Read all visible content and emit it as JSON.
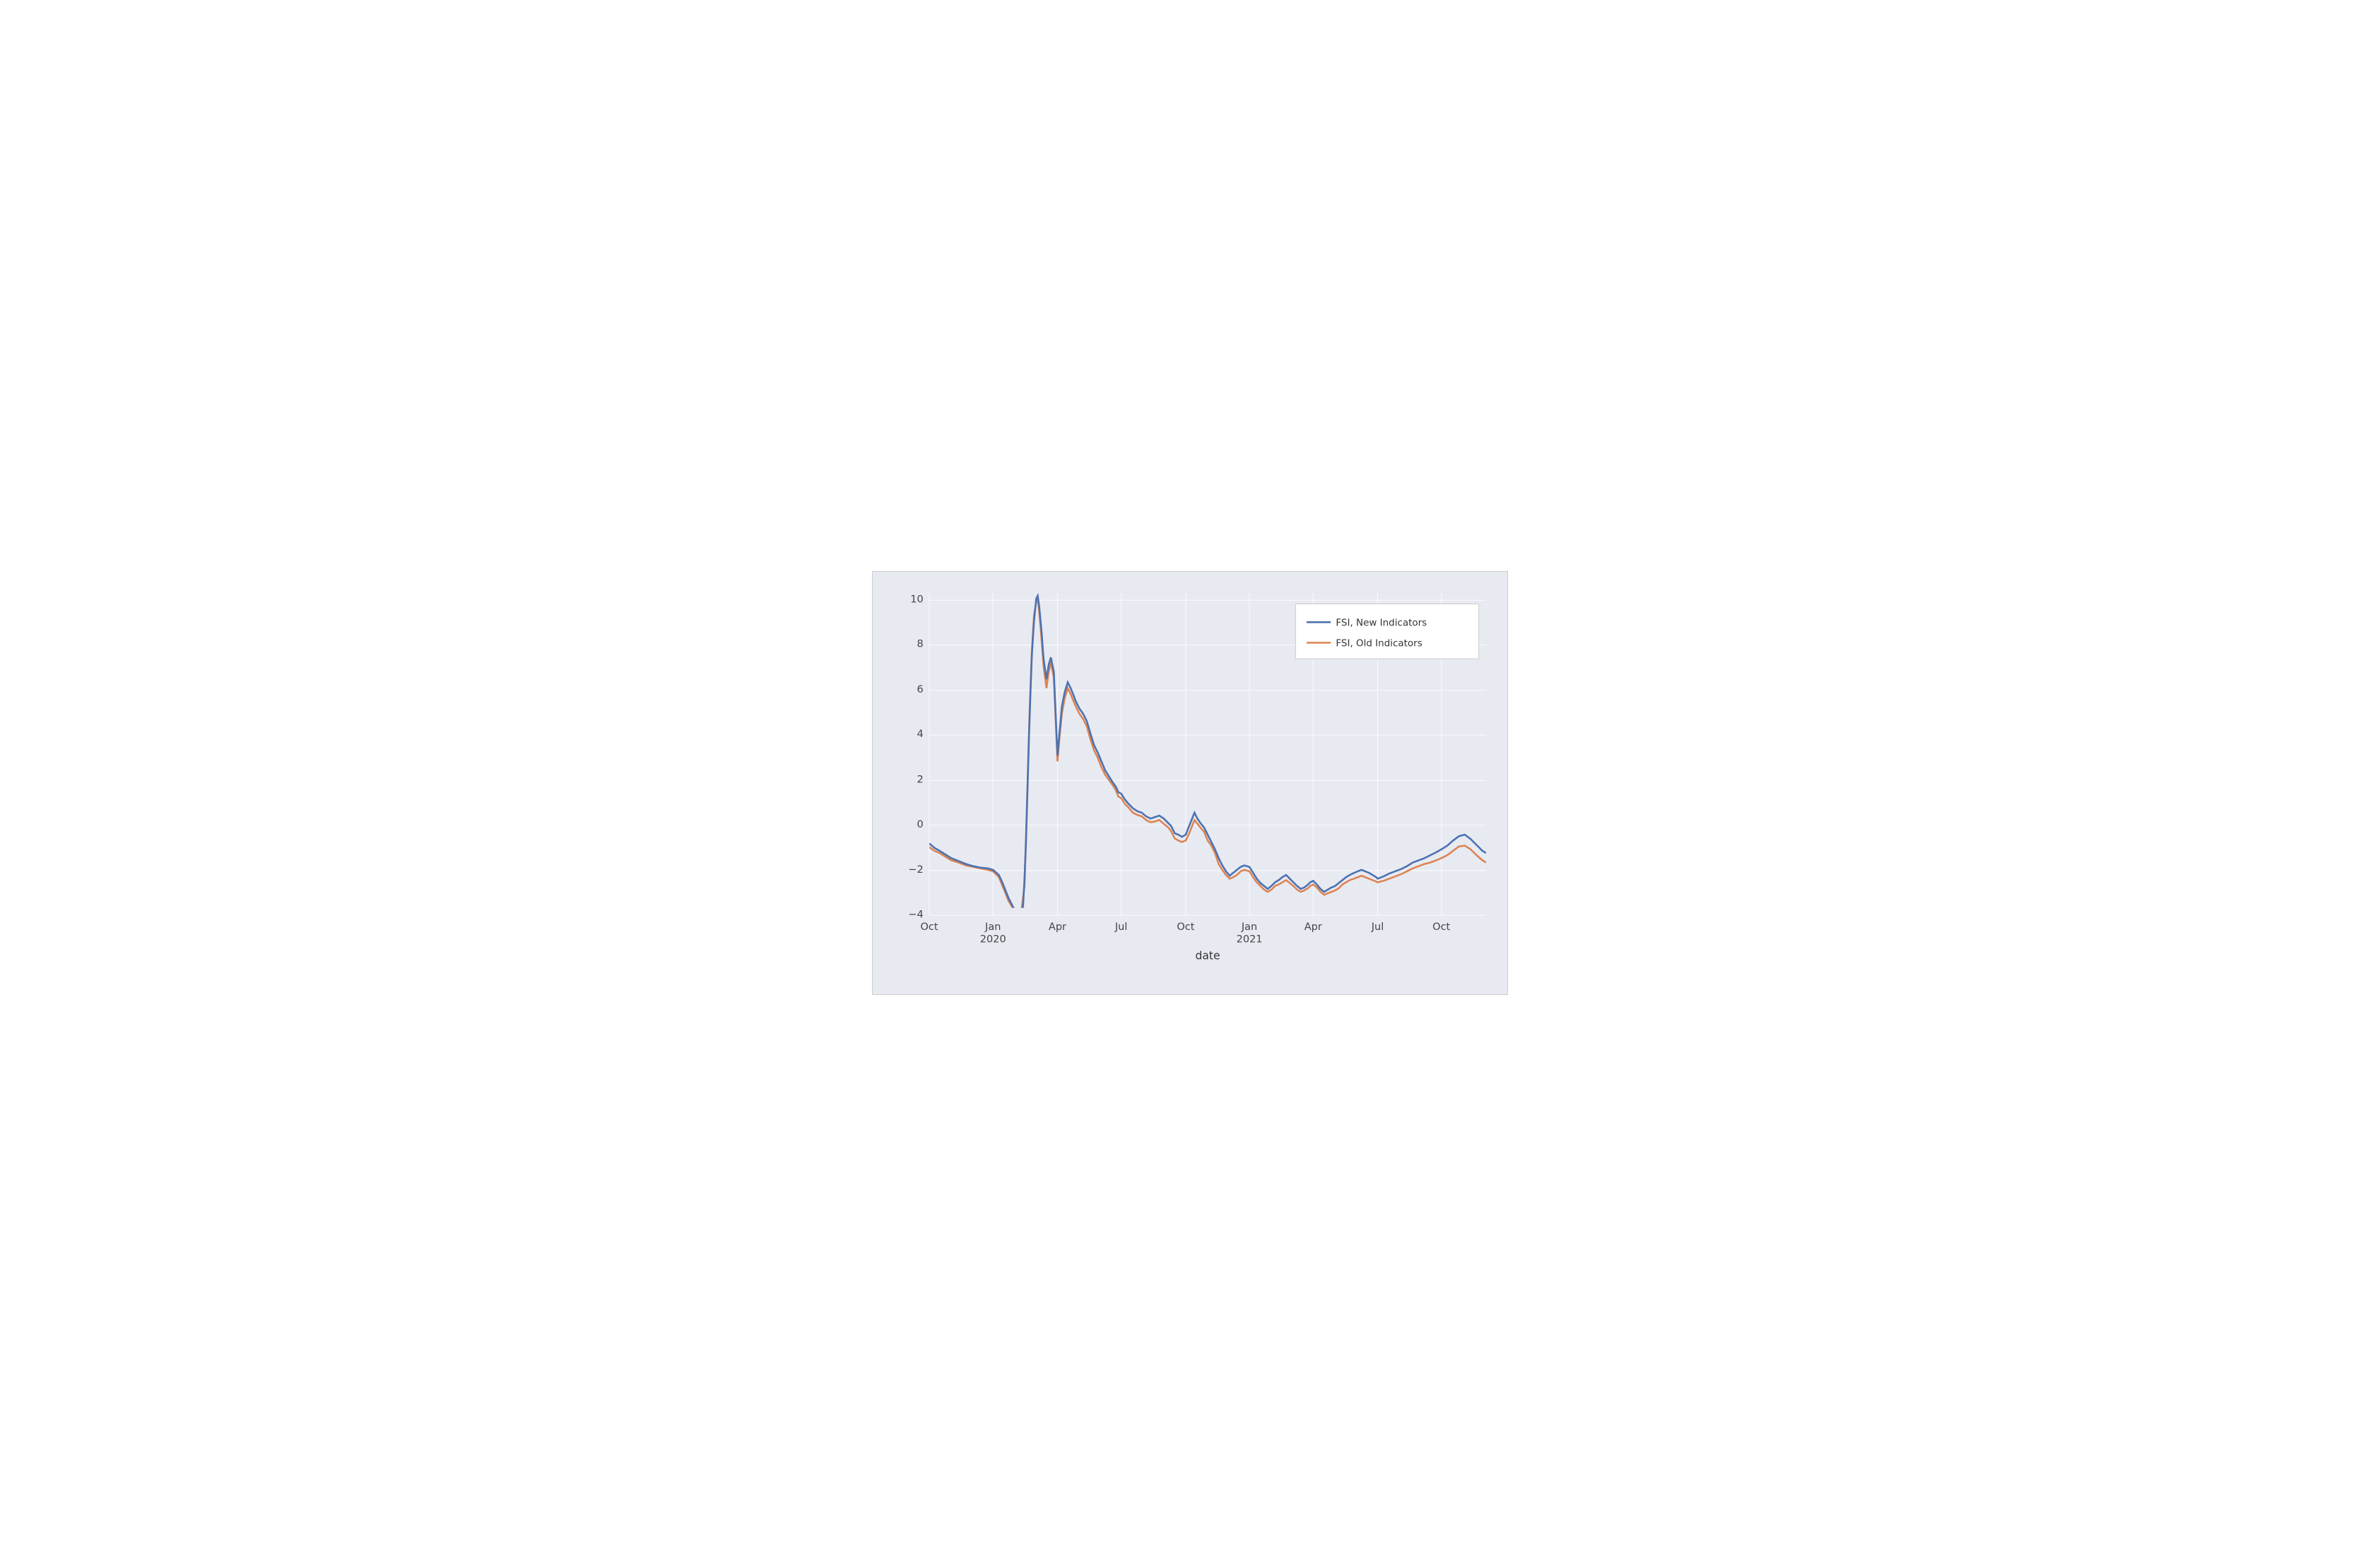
{
  "chart": {
    "title": "",
    "x_axis_label": "date",
    "y_axis": {
      "min": -5,
      "max": 11,
      "ticks": [
        10,
        8,
        6,
        4,
        2,
        0,
        -2,
        -4
      ]
    },
    "x_axis": {
      "ticks": [
        {
          "label": "Oct",
          "year": "",
          "position": 0.0
        },
        {
          "label": "Jan",
          "year": "2020",
          "position": 0.115
        },
        {
          "label": "Apr",
          "year": "",
          "position": 0.23
        },
        {
          "label": "Jul",
          "year": "",
          "position": 0.345
        },
        {
          "label": "Oct",
          "year": "",
          "position": 0.46
        },
        {
          "label": "Jan",
          "year": "2021",
          "position": 0.575
        },
        {
          "label": "Apr",
          "year": "",
          "position": 0.69
        },
        {
          "label": "Jul",
          "year": "",
          "position": 0.805
        },
        {
          "label": "Oct",
          "year": "",
          "position": 0.92
        }
      ]
    },
    "legend": {
      "items": [
        {
          "label": "FSI, New Indicators",
          "color": "#4c72b0"
        },
        {
          "label": "FSI, Old Indicators",
          "color": "#dd8452"
        }
      ]
    },
    "colors": {
      "background": "#e8eaf2",
      "grid": "#ffffff",
      "blue_line": "#4c72b0",
      "orange_line": "#dd8452"
    }
  }
}
